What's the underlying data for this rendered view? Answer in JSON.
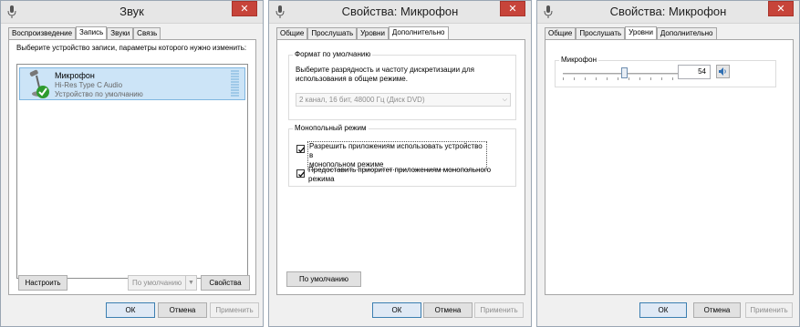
{
  "colors": {
    "close": "#c7443a",
    "selection": "#cce4f7",
    "primary_border": "#3c7fb1",
    "check_green": "#2e9b2f"
  },
  "window1": {
    "title": "Звук",
    "close_icon": "close-icon",
    "tabs": [
      "Воспроизведение",
      "Запись",
      "Звуки",
      "Связь"
    ],
    "instruction": "Выберите устройство записи, параметры которого нужно изменить:",
    "device": {
      "name": "Микрофон",
      "description": "Hi-Res Type C Audio",
      "status": "Устройство по умолчанию"
    },
    "configure_label": "Настроить",
    "default_label": "По умолчанию",
    "properties_label": "Свойства",
    "ok_label": "ОК",
    "cancel_label": "Отмена",
    "apply_label": "Применить"
  },
  "window2": {
    "title": "Свойства: Микрофон",
    "tabs": [
      "Общие",
      "Прослушать",
      "Уровни",
      "Дополнительно"
    ],
    "format_group_label": "Формат по умолчанию",
    "format_desc_line1": "Выберите разрядность и частоту дискретизации для",
    "format_desc_line2": "использования в общем режиме.",
    "format_value": "2 канал, 16 бит, 48000 Гц (Диск DVD)",
    "exclusive_group_label": "Монопольный режим",
    "allow_exclusive_line1": "Разрешить приложениям использовать устройство в",
    "allow_exclusive_line2": "монопольном режиме",
    "allow_exclusive_checked": true,
    "priority_line1": "Предоставить приоритет приложениям монопольного",
    "priority_line2": "режима",
    "priority_checked": true,
    "restore_default_label": "По умолчанию",
    "ok_label": "ОК",
    "cancel_label": "Отмена",
    "apply_label": "Применить"
  },
  "window3": {
    "title": "Свойства: Микрофон",
    "tabs": [
      "Общие",
      "Прослушать",
      "Уровни",
      "Дополнительно"
    ],
    "mic_group_label": "Микрофон",
    "level_value": "54",
    "level_fraction": 0.54,
    "ok_label": "ОК",
    "cancel_label": "Отмена",
    "apply_label": "Применить"
  }
}
